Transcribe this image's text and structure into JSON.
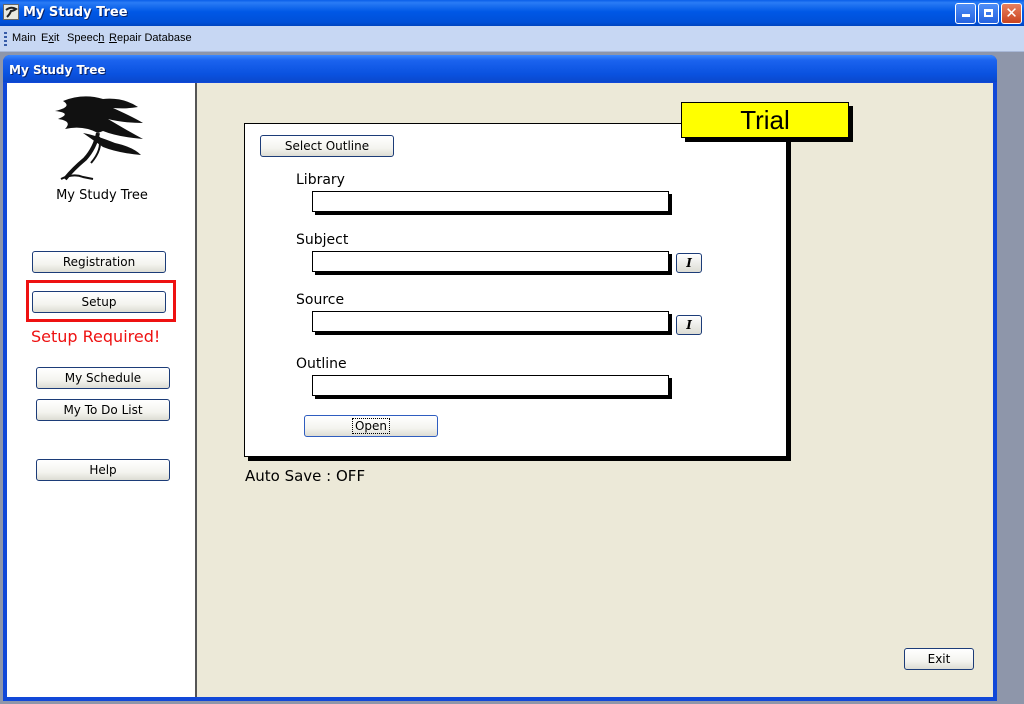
{
  "window": {
    "title": "My Study Tree",
    "controls": [
      "minimize",
      "restore",
      "close"
    ]
  },
  "menu": {
    "items": [
      {
        "label": "Main",
        "accel": ""
      },
      {
        "label": "Exit",
        "accel": "x"
      },
      {
        "label": "Speech",
        "accel": "h"
      },
      {
        "label": "Repair Database",
        "accel": "R"
      }
    ]
  },
  "child_window": {
    "title": "My Study Tree"
  },
  "sidebar": {
    "logo_text": "My Study Tree",
    "buttons": {
      "registration": "Registration",
      "setup": "Setup",
      "schedule": "My Schedule",
      "todo": "My To Do List",
      "help": "Help"
    },
    "warning": "Setup Required!",
    "warning_color": "#ee1111"
  },
  "main": {
    "trial_badge": "Trial",
    "trial_color": "#ffff00",
    "select_outline_button": "Select Outline",
    "fields": {
      "library": {
        "label": "Library",
        "value": ""
      },
      "subject": {
        "label": "Subject",
        "value": ""
      },
      "source": {
        "label": "Source",
        "value": ""
      },
      "outline": {
        "label": "Outline",
        "value": ""
      }
    },
    "italic_button_glyph": "I",
    "open_button": "Open",
    "auto_save": "Auto Save : OFF",
    "exit_button": "Exit"
  }
}
